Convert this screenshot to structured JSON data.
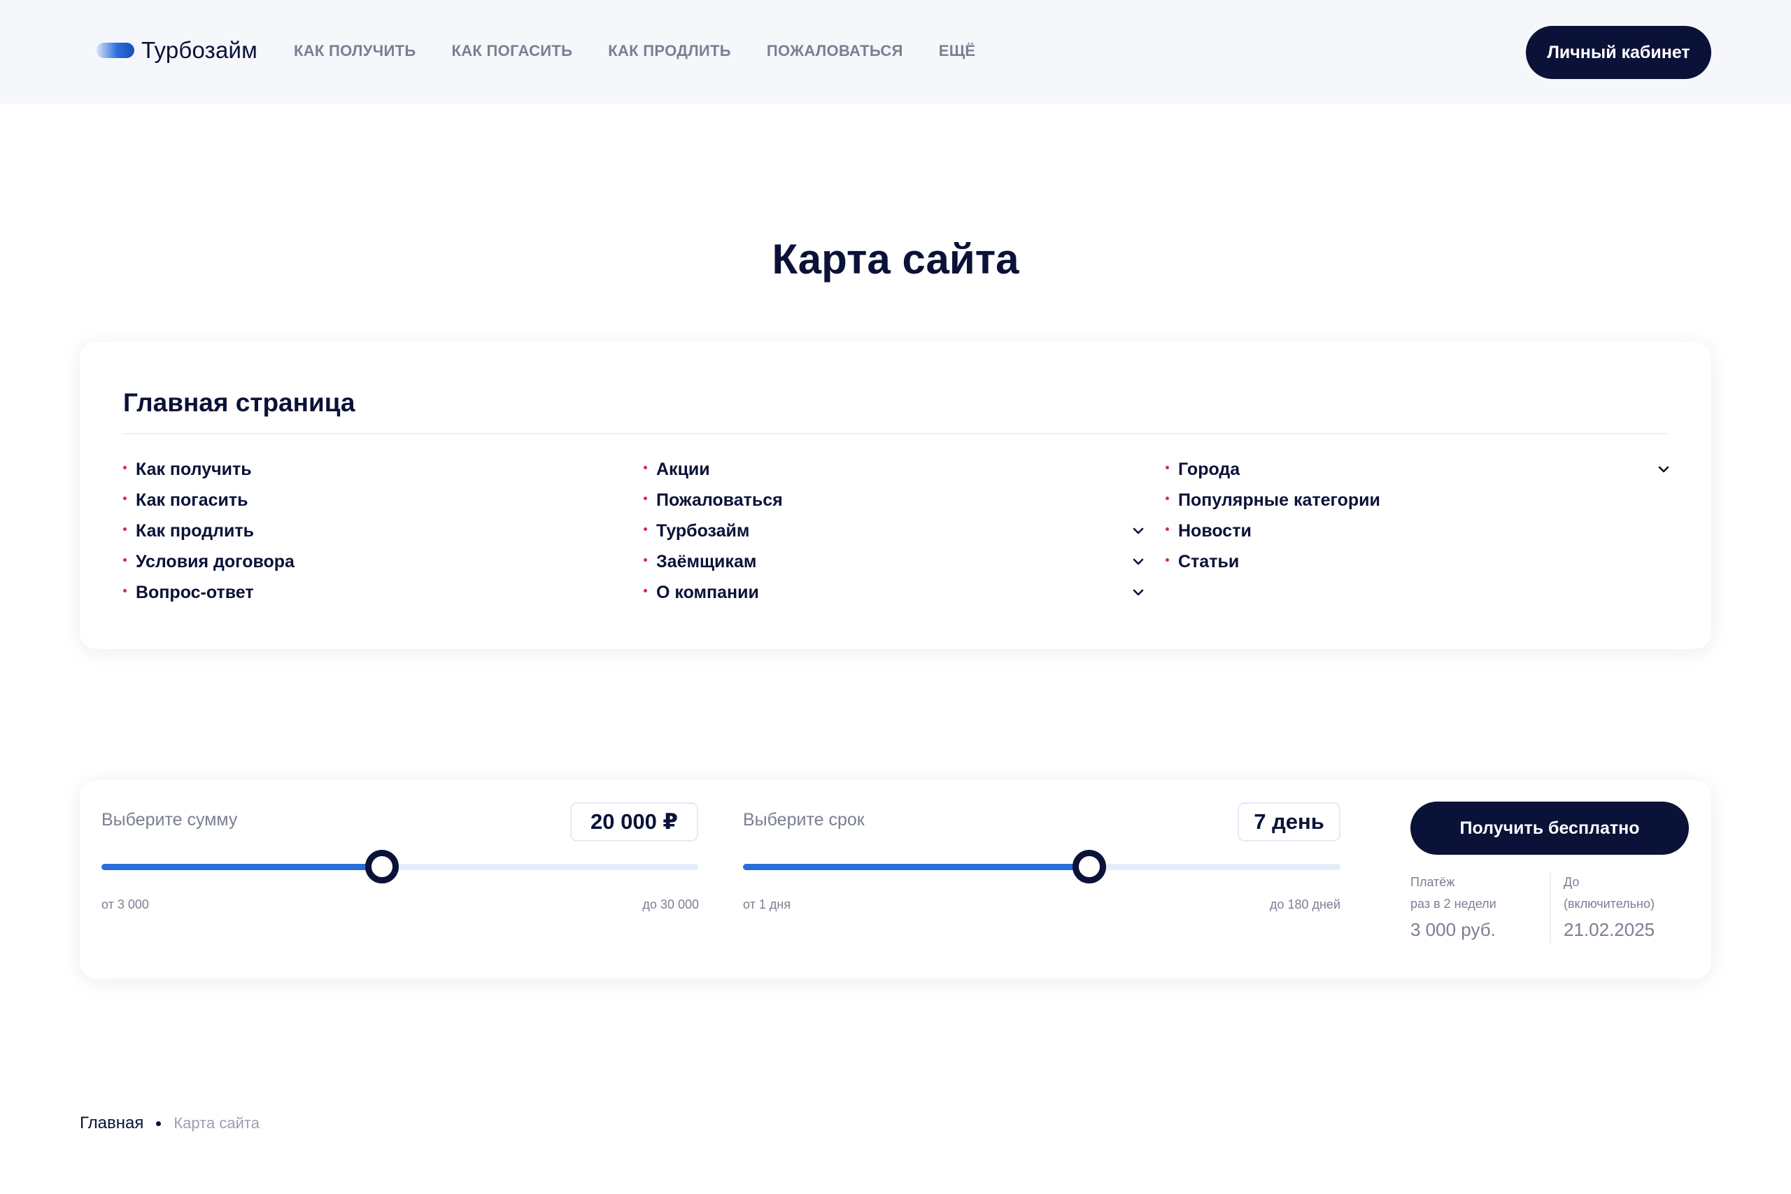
{
  "header": {
    "logo_text": "Турбозайм",
    "nav": [
      "КАК ПОЛУЧИТЬ",
      "КАК ПОГАСИТЬ",
      "КАК ПРОДЛИТЬ",
      "ПОЖАЛОВАТЬСЯ",
      "ЕЩЁ"
    ],
    "cabinet_label": "Личный кабинет"
  },
  "page_title": "Карта сайта",
  "sitemap": {
    "title": "Главная страница",
    "col1": [
      "Как получить",
      "Как погасить",
      "Как продлить",
      "Условия договора",
      "Вопрос-ответ"
    ],
    "col2": [
      "Акции",
      "Пожаловаться",
      "Турбозайм",
      "Заёмщикам",
      "О компании"
    ],
    "col3": [
      "Города",
      "Популярные категории",
      "Новости",
      "Статьи"
    ]
  },
  "calculator": {
    "amount": {
      "label": "Выберите сумму",
      "value": "20 000 ₽",
      "min_label": "от 3 000",
      "max_label": "до 30 000",
      "fill_fraction": 0.47
    },
    "term": {
      "label": "Выберите срок",
      "value": "7 день",
      "min_label": "от 1 дня",
      "max_label": "до 180 дней",
      "fill_fraction": 0.58
    },
    "cta_label": "Получить бесплатно",
    "payment": {
      "line1": "Платёж",
      "line2": "раз в 2 недели",
      "value": "3 000 руб."
    },
    "due": {
      "line1": "До",
      "line2": "(включительно)",
      "value": "21.02.2025"
    }
  },
  "breadcrumb": {
    "home": "Главная",
    "current": "Карта сайта"
  },
  "colors": {
    "primary_dark": "#0b1238",
    "accent_blue": "#2a6edc",
    "bullet_pink": "#d6245f",
    "muted_text": "#7a7f92"
  }
}
